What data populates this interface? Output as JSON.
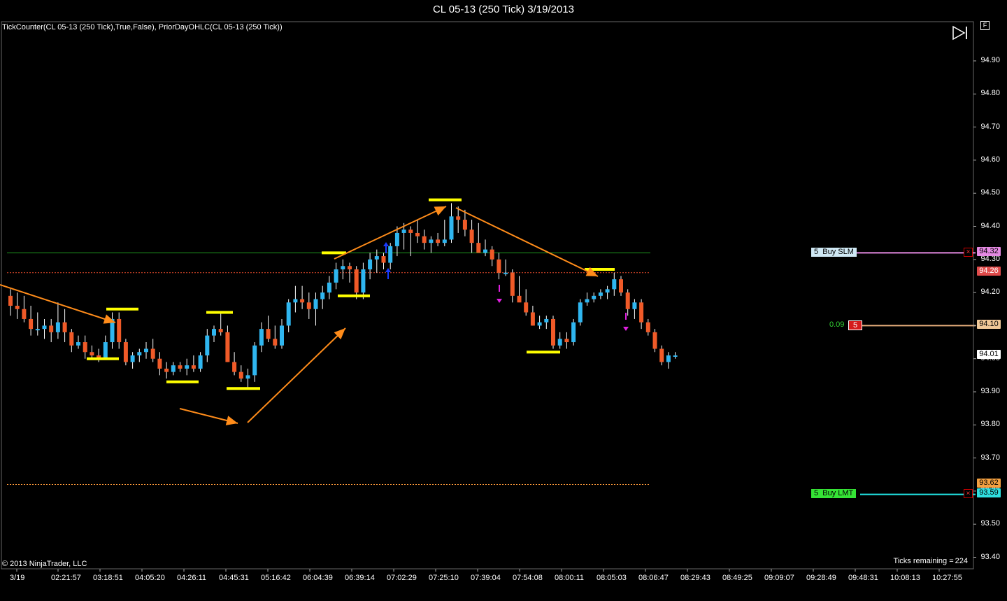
{
  "window": {
    "title": "CL 05-13 (250 Tick)  3/19/2013"
  },
  "indicator_label": "TickCounter(CL 05-13 (250 Tick),True,False), PriorDayOHLC(CL 05-13 (250 Tick))",
  "copyright": "© 2013 NinjaTrader, LLC",
  "ticks_remaining": {
    "label": "Ticks remaining =",
    "value": "224"
  },
  "toolbar": {
    "f_label": "F"
  },
  "y_axis": {
    "labels": [
      "94.90",
      "94.80",
      "94.70",
      "94.60",
      "94.50",
      "94.40",
      "94.30",
      "94.20",
      "94.10",
      "94.00",
      "93.90",
      "93.80",
      "93.70",
      "93.60",
      "93.50",
      "93.40"
    ]
  },
  "x_axis": {
    "labels": [
      "3/19",
      "02:21:57",
      "03:18:51",
      "04:05:20",
      "04:26:11",
      "04:45:31",
      "05:16:42",
      "06:04:39",
      "06:39:14",
      "07:02:29",
      "07:25:10",
      "07:39:04",
      "07:54:08",
      "08:00:11",
      "08:05:03",
      "08:06:47",
      "08:29:43",
      "08:49:25",
      "09:09:07",
      "09:28:49",
      "09:48:31",
      "10:08:13",
      "10:27:55"
    ]
  },
  "price_tags": {
    "buy_slm": "94.32",
    "prior_high": "94.26",
    "position": "94.10",
    "last": "94.01",
    "prior_low": "93.62",
    "buy_lmt": "93.59"
  },
  "orders": {
    "slm": {
      "qty": "5",
      "label": "Buy SLM"
    },
    "lmt": {
      "qty": "5",
      "label": "Buy LMT"
    }
  },
  "position": {
    "pnl": "0.09",
    "qty": "5"
  },
  "colors": {
    "up": "#2fb6f0",
    "down": "#f05a28",
    "wick": "#ffffff",
    "level": "#ffff00",
    "arrow": "#ff8c1a",
    "prior_high_line": "#e84a2c",
    "prior_low_line": "#ff9a3a",
    "green_line": "#1f9a1f",
    "slm_line": "#e58ae3",
    "position_line": "#e8b07c",
    "lmt_line": "#22e5e5",
    "slm_tag": "#e58ae3",
    "prior_high_tag": "#e04b4b",
    "position_tag": "#f0c898",
    "last_tag": "#ffffff",
    "prior_low_tag": "#f4a040",
    "lmt_tag": "#2fe0e0"
  },
  "chart_data": {
    "type": "candlestick",
    "instrument": "CL 05-13",
    "interval": "250 Tick",
    "ylim": [
      93.4,
      94.92
    ],
    "candles": [
      [
        94.19,
        94.21,
        94.13,
        94.16
      ],
      [
        94.16,
        94.2,
        94.12,
        94.15
      ],
      [
        94.15,
        94.19,
        94.11,
        94.12
      ],
      [
        94.12,
        94.16,
        94.07,
        94.09
      ],
      [
        94.09,
        94.14,
        94.07,
        94.09
      ],
      [
        94.09,
        94.12,
        94.06,
        94.1
      ],
      [
        94.1,
        94.12,
        94.05,
        94.08
      ],
      [
        94.08,
        94.17,
        94.06,
        94.11
      ],
      [
        94.11,
        94.15,
        94.05,
        94.08
      ],
      [
        94.08,
        94.09,
        94.02,
        94.04
      ],
      [
        94.04,
        94.07,
        94.03,
        94.05
      ],
      [
        94.05,
        94.07,
        94.0,
        94.02
      ],
      [
        94.02,
        94.04,
        94.0,
        94.01
      ],
      [
        94.01,
        94.03,
        93.99,
        94.0
      ],
      [
        94.0,
        94.07,
        94.0,
        94.05
      ],
      [
        94.05,
        94.14,
        94.03,
        94.12
      ],
      [
        94.12,
        94.14,
        94.03,
        94.05
      ],
      [
        94.05,
        94.06,
        93.98,
        93.99
      ],
      [
        93.99,
        94.02,
        93.97,
        94.01
      ],
      [
        94.01,
        94.03,
        93.99,
        94.02
      ],
      [
        94.02,
        94.05,
        94.0,
        94.03
      ],
      [
        94.03,
        94.06,
        93.99,
        94.0
      ],
      [
        94.0,
        94.02,
        93.95,
        93.97
      ],
      [
        93.97,
        93.99,
        93.94,
        93.96
      ],
      [
        93.96,
        93.99,
        93.95,
        93.98
      ],
      [
        93.98,
        93.99,
        93.96,
        93.97
      ],
      [
        93.97,
        94.0,
        93.95,
        93.98
      ],
      [
        93.98,
        94.01,
        93.96,
        93.97
      ],
      [
        93.97,
        94.02,
        93.96,
        94.01
      ],
      [
        94.01,
        94.09,
        93.99,
        94.07
      ],
      [
        94.07,
        94.1,
        94.05,
        94.09
      ],
      [
        94.09,
        94.14,
        94.07,
        94.08
      ],
      [
        94.08,
        94.1,
        93.99,
        93.99
      ],
      [
        93.99,
        94.02,
        93.95,
        93.96
      ],
      [
        93.96,
        93.98,
        93.93,
        93.94
      ],
      [
        93.94,
        93.97,
        93.91,
        93.95
      ],
      [
        93.95,
        94.05,
        93.93,
        94.04
      ],
      [
        94.04,
        94.11,
        94.02,
        94.09
      ],
      [
        94.09,
        94.13,
        94.05,
        94.06
      ],
      [
        94.06,
        94.1,
        94.03,
        94.04
      ],
      [
        94.04,
        94.12,
        94.03,
        94.1
      ],
      [
        94.1,
        94.18,
        94.08,
        94.17
      ],
      [
        94.17,
        94.22,
        94.14,
        94.18
      ],
      [
        94.18,
        94.22,
        94.15,
        94.17
      ],
      [
        94.17,
        94.2,
        94.12,
        94.15
      ],
      [
        94.15,
        94.2,
        94.1,
        94.18
      ],
      [
        94.18,
        94.22,
        94.15,
        94.2
      ],
      [
        94.2,
        94.25,
        94.18,
        94.23
      ],
      [
        94.23,
        94.29,
        94.21,
        94.27
      ],
      [
        94.27,
        94.3,
        94.24,
        94.28
      ],
      [
        94.28,
        94.29,
        94.23,
        94.27
      ],
      [
        94.27,
        94.28,
        94.18,
        94.2
      ],
      [
        94.2,
        94.29,
        94.18,
        94.27
      ],
      [
        94.27,
        94.32,
        94.24,
        94.3
      ],
      [
        94.3,
        94.33,
        94.26,
        94.31
      ],
      [
        94.31,
        94.32,
        94.27,
        94.29
      ],
      [
        94.29,
        94.35,
        94.27,
        94.34
      ],
      [
        94.34,
        94.4,
        94.31,
        94.38
      ],
      [
        94.38,
        94.41,
        94.33,
        94.39
      ],
      [
        94.39,
        94.4,
        94.31,
        94.38
      ],
      [
        94.38,
        94.42,
        94.35,
        94.37
      ],
      [
        94.37,
        94.39,
        94.33,
        94.35
      ],
      [
        94.35,
        94.37,
        94.32,
        94.36
      ],
      [
        94.36,
        94.38,
        94.34,
        94.35
      ],
      [
        94.35,
        94.42,
        94.34,
        94.36
      ],
      [
        94.36,
        94.47,
        94.35,
        94.43
      ],
      [
        94.43,
        94.46,
        94.38,
        94.42
      ],
      [
        94.42,
        94.45,
        94.37,
        94.39
      ],
      [
        94.39,
        94.42,
        94.32,
        94.35
      ],
      [
        94.35,
        94.41,
        94.33,
        94.32
      ],
      [
        94.32,
        94.36,
        94.31,
        94.33
      ],
      [
        94.33,
        94.34,
        94.28,
        94.3
      ],
      [
        94.3,
        94.32,
        94.24,
        94.26
      ],
      [
        94.26,
        94.3,
        94.25,
        94.26
      ],
      [
        94.26,
        94.27,
        94.17,
        94.19
      ],
      [
        94.19,
        94.25,
        94.18,
        94.17
      ],
      [
        94.17,
        94.21,
        94.13,
        94.14
      ],
      [
        94.14,
        94.16,
        94.1,
        94.1
      ],
      [
        94.1,
        94.13,
        94.09,
        94.11
      ],
      [
        94.11,
        94.13,
        94.09,
        94.12
      ],
      [
        94.12,
        94.13,
        94.03,
        94.04
      ],
      [
        94.04,
        94.08,
        94.03,
        94.06
      ],
      [
        94.06,
        94.08,
        94.03,
        94.05
      ],
      [
        94.05,
        94.12,
        94.04,
        94.11
      ],
      [
        94.11,
        94.18,
        94.1,
        94.17
      ],
      [
        94.17,
        94.2,
        94.16,
        94.18
      ],
      [
        94.18,
        94.2,
        94.17,
        94.19
      ],
      [
        94.19,
        94.21,
        94.18,
        94.2
      ],
      [
        94.2,
        94.22,
        94.18,
        94.21
      ],
      [
        94.21,
        94.26,
        94.19,
        94.24
      ],
      [
        94.24,
        94.25,
        94.19,
        94.2
      ],
      [
        94.2,
        94.21,
        94.13,
        94.15
      ],
      [
        94.15,
        94.18,
        94.12,
        94.17
      ],
      [
        94.17,
        94.18,
        94.09,
        94.11
      ],
      [
        94.11,
        94.12,
        94.07,
        94.08
      ],
      [
        94.08,
        94.09,
        94.02,
        94.03
      ],
      [
        94.03,
        94.04,
        93.98,
        93.99
      ],
      [
        93.99,
        94.02,
        93.97,
        94.01
      ],
      [
        94.01,
        94.02,
        94.0,
        94.01
      ]
    ],
    "horizontal_levels": {
      "prior_day_high": 94.26,
      "prior_day_low": 93.62,
      "green_line": 94.32,
      "buy_slm": 94.32,
      "position": 94.1,
      "buy_lmt": 93.59
    }
  }
}
